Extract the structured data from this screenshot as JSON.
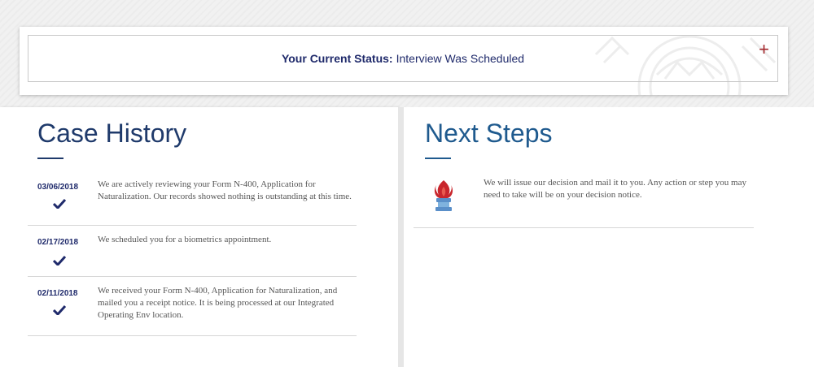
{
  "status": {
    "label": "Your Current Status:",
    "value": "Interview Was Scheduled",
    "expand_icon": "plus-icon",
    "expand_symbol": "+"
  },
  "case_history": {
    "title": "Case History",
    "items": [
      {
        "date": "03/06/2018",
        "icon": "checkmark-icon",
        "text": "We are actively reviewing your Form N-400, Application for Naturalization. Our records showed nothing is outstanding at this time."
      },
      {
        "date": "02/17/2018",
        "icon": "checkmark-icon",
        "text": "We scheduled you for a biometrics appointment."
      },
      {
        "date": "02/11/2018",
        "icon": "checkmark-icon",
        "text": "We received your Form N-400, Application for Naturalization, and mailed you a receipt notice. It is being processed at our Integrated Operating Env location."
      }
    ]
  },
  "next_steps": {
    "title": "Next Steps",
    "icon": "torch-icon",
    "text": "We will issue our decision and mail it to you.  Any action or step you may need to take will be on your decision notice."
  },
  "colors": {
    "navy": "#1f2a6b",
    "title_blue": "#1f5a8e",
    "accent_red": "#a3262b",
    "body_text": "#555555"
  }
}
